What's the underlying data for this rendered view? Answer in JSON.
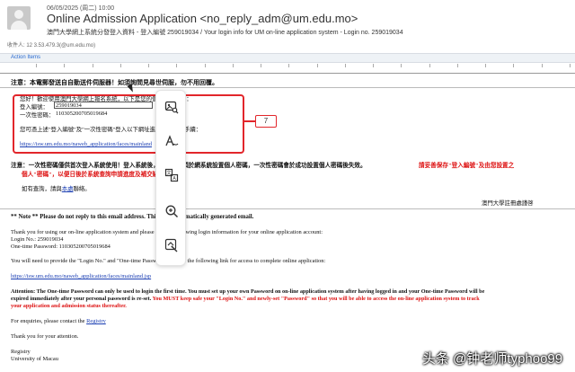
{
  "header": {
    "date": "06/05/2025 (周二) 10:00",
    "subject": "Online Admission Application <no_reply_adm@um.edu.mo>",
    "subtitle": "澳門大學網上系統分發登入資料 - 登入編號 259019034 / Your login info for UM on-line application system - Login no. 259019034",
    "to": "收件人: 12 3.53.479.3(@um.edu.mo)"
  },
  "action_bar": {
    "label": "Action Items"
  },
  "chinese": {
    "notice": "注意：本電郵發送自自動送件伺服器！如須詢問見尋世伺服，勿不用回覆。",
    "greeting": "您好！歡迎使用澳門大學網上報名系統，以下是您的個人帳戶資料：",
    "login_label": "登入編號：",
    "login_value": "259019034",
    "otp_label": "一次性密碼：",
    "otp_value": "110305200705019684",
    "instruction": "您可憑上述\"登入編號\"及\"一次性密碼\"登入以下網址進行網上報名手續：",
    "link": "https://isw.um.edu.mo/naweb_application/faces/mainland",
    "warning_lead": "注意：一次性密碼僅供首次登入系統使用！登入系統後，申請人必須於網系統設置個人密碼，一次性密碼會於成功設置個人密碼後失效。",
    "warning_red1": "請妥善保存\"登入編號\"及由您設置之",
    "warning_red2": "個人\"密碼\"，以便日後於系統查詢申請進度及補交缺漏資料。",
    "enquiry_pre": "如有查詢，請與",
    "enquiry_link": "本處",
    "enquiry_post": "聯絡。",
    "sign": "澳門大學註冊處謹啓"
  },
  "english": {
    "note": "** Note ** Please do not reply to this email address. This is an automatically generated email.",
    "p1": "Thank you for using our on-line application system and please find the following login information for your online application account:",
    "login": "Login No.:  259019034",
    "otp": "One-time Password:   110305200705019684",
    "p2": "You will need to provide the \"Login No.\" and \"One-time Password\" to login the following link for access to complete online application:",
    "link": "https://isw.um.edu.mo/naweb_application/faces/mainland.jsp",
    "att1": "Attention: The One-time Password can only be used to login the first time. You must set up your own Password on on-line application system after having logged in and your One-time Password will be",
    "att2_a": "expired immediately after your personal password is re-set. ",
    "att2_b": "You MUST keep safe your \"Login No.\" and newly-set \"Password\" so that you will be able to access the on-line application system to track",
    "att3": "your application and admission status thereafter.",
    "enquiry_pre": "For enquiries, please contact the ",
    "enquiry_link": "Registry",
    "thanks": "Thank you for your attention.",
    "sig1": "Registry",
    "sig2": "University of Macau"
  },
  "callout": {
    "number": "7"
  },
  "toolbar_icons": [
    "image-search-icon",
    "handwriting-icon",
    "translate-icon",
    "zoom-in-icon",
    "scan-icon"
  ],
  "watermark": "头条 @钟老师typhoo99",
  "colors": {
    "accent": "#e2262b",
    "link": "#1b3fb3",
    "warning": "#d11111"
  }
}
